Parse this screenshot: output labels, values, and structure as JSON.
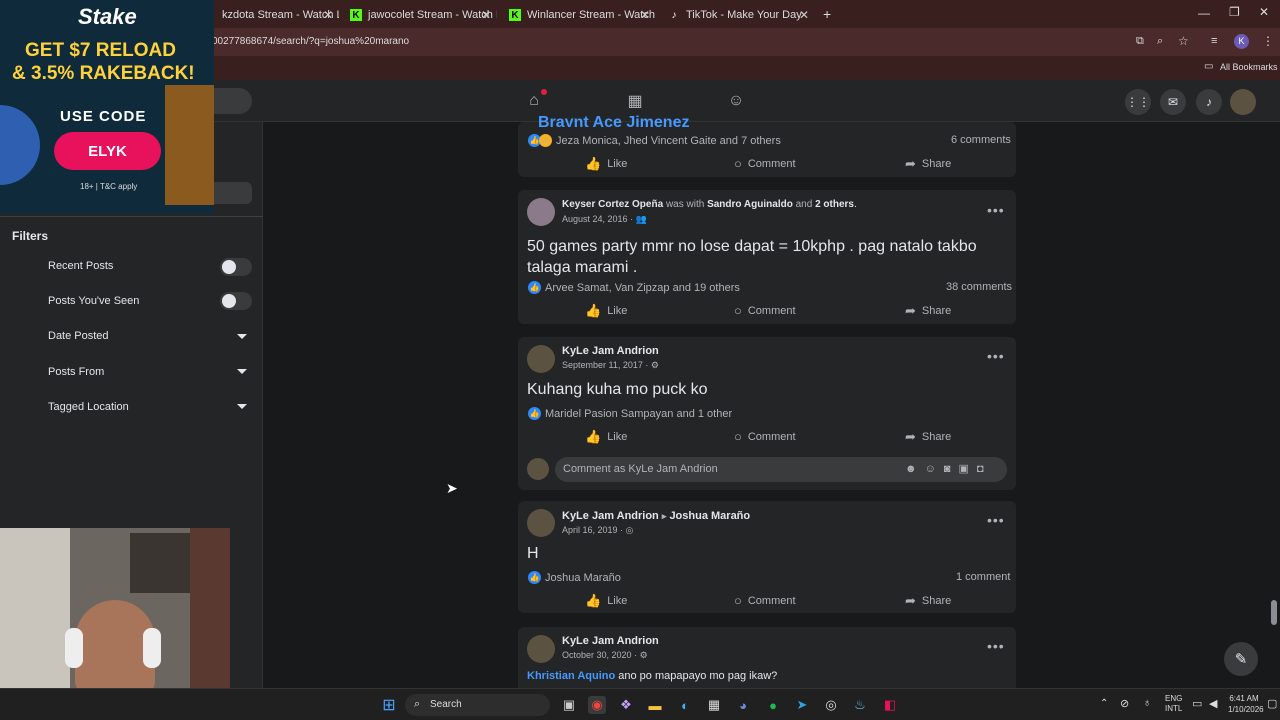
{
  "browser": {
    "tabs": [
      {
        "title": "kzdota Stream - Watch Live"
      },
      {
        "title": "jawocolet Stream - Watch Live"
      },
      {
        "title": "Winlancer Stream - Watch Live"
      },
      {
        "title": "TikTok - Make Your Day"
      }
    ],
    "url": "00277868674/search/?q=joshua%20marano",
    "bookmarks_label": "All Bookmarks",
    "profile_letter": "K"
  },
  "ad": {
    "brand": "Stake",
    "headline1": "GET $7 RELOAD",
    "headline2": "& 3.5% RAKEBACK!",
    "use_code": "USE CODE",
    "code": "ELYK",
    "disclaimer": "18+ | T&C apply"
  },
  "filters": {
    "title": "Filters",
    "items": [
      {
        "label": "Recent Posts",
        "type": "toggle"
      },
      {
        "label": "Posts You've Seen",
        "type": "toggle"
      },
      {
        "label": "Date Posted",
        "type": "dropdown"
      },
      {
        "label": "Posts From",
        "type": "dropdown"
      },
      {
        "label": "Tagged Location",
        "type": "dropdown"
      }
    ]
  },
  "actions": {
    "like": "Like",
    "comment": "Comment",
    "share": "Share"
  },
  "posts": [
    {
      "partial_name": "Braynt Ace Jimenez",
      "reactions": "Jeza Monica, Jhed Vincent Gaite and 7 others",
      "comments": "6 comments"
    },
    {
      "author": "Keyser Cortez Opeña",
      "with_text": "was with",
      "with_name": "Sandro Aguinaldo",
      "and_text": "and",
      "others": "2 others",
      "date": "August 24, 2016",
      "text": "50 games party mmr no lose dapat = 10kphp . pag natalo takbo talaga marami .",
      "reactions": "Arvee Samat, Van Zipzap and 19 others",
      "comments": "38 comments"
    },
    {
      "author": "KyLe Jam Andrion",
      "date": "September 11, 2017",
      "text": "Kuhang kuha mo puck ko",
      "reactions": "Maridel Pasion Sampayan and 1 other",
      "comment_placeholder": "Comment as KyLe Jam Andrion"
    },
    {
      "author": "KyLe Jam Andrion",
      "target": "Joshua Marañо",
      "date": "April 16, 2019",
      "text": "H",
      "reactions": "Joshua Marañо",
      "comments": "1 comment"
    },
    {
      "author": "KyLe Jam Andrion",
      "date": "October 30, 2020",
      "mention": "Khristian Aquino",
      "text": "ano po mapapayo mo pag ikaw?"
    }
  ],
  "taskbar": {
    "search_label": "Search",
    "lang1": "ENG",
    "lang2": "INTL",
    "time": "6:41 AM",
    "date": "1/10/2026"
  }
}
